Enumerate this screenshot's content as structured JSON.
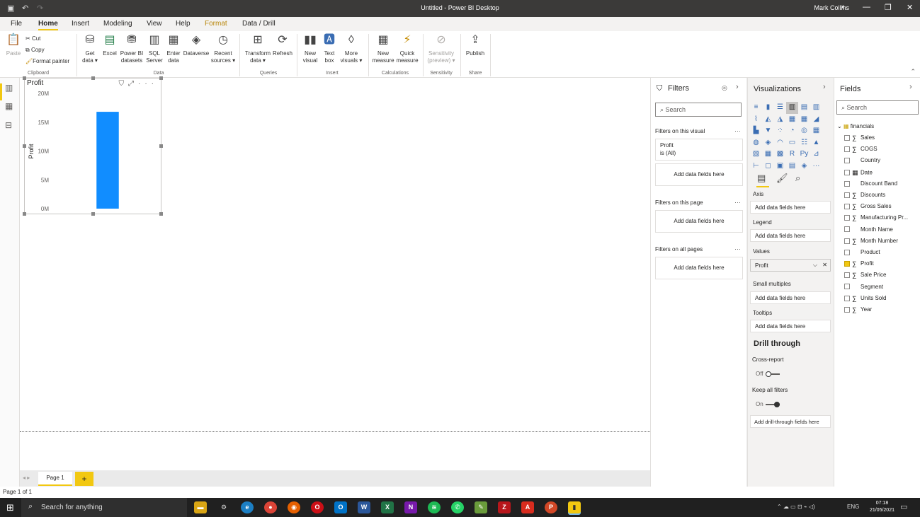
{
  "window": {
    "title": "Untitled - Power BI Desktop",
    "user": "Mark Collins"
  },
  "menu": [
    "File",
    "Home",
    "Insert",
    "Modeling",
    "View",
    "Help",
    "Format",
    "Data / Drill"
  ],
  "ribbon": {
    "paste": "Paste",
    "cut": "Cut",
    "copy": "Copy",
    "format_painter": "Format painter",
    "get_data": [
      "Get",
      "data ▾"
    ],
    "excel": "Excel",
    "pbi_datasets": [
      "Power BI",
      "datasets"
    ],
    "sql_server": [
      "SQL",
      "Server"
    ],
    "enter_data": [
      "Enter",
      "data"
    ],
    "dataverse": "Dataverse",
    "recent_sources": [
      "Recent",
      "sources ▾"
    ],
    "transform_data": [
      "Transform",
      "data ▾"
    ],
    "refresh": "Refresh",
    "new_visual": [
      "New",
      "visual"
    ],
    "text_box": [
      "Text",
      "box"
    ],
    "more_visuals": [
      "More",
      "visuals ▾"
    ],
    "new_measure": [
      "New",
      "measure"
    ],
    "quick_measure": [
      "Quick",
      "measure"
    ],
    "sensitivity": [
      "Sensitivity",
      "(preview) ▾"
    ],
    "publish": "Publish",
    "groups": [
      "Clipboard",
      "Data",
      "Queries",
      "Insert",
      "Calculations",
      "Sensitivity",
      "Share"
    ]
  },
  "visual": {
    "title": "Profit",
    "ylabel": "Profit",
    "icons": [
      "filter-icon",
      "focus-mode-icon",
      "more-options-icon"
    ]
  },
  "chart_data": {
    "type": "bar",
    "categories": [
      ""
    ],
    "values": [
      16.8
    ],
    "ylabel": "Profit",
    "ylim": [
      0,
      20
    ],
    "yticks": [
      "20M",
      "15M",
      "10M",
      "5M",
      "0M"
    ],
    "bar_color": "#118dff"
  },
  "pages": {
    "tab": "Page 1",
    "add": "+",
    "status": "Page 1 of 1"
  },
  "filters": {
    "title": "Filters",
    "search": "Search",
    "on_visual": "Filters on this visual",
    "card_field": "Profit",
    "card_value": "is (All)",
    "add_here": "Add data fields here",
    "on_page": "Filters on this page",
    "on_all": "Filters on all pages",
    "dots": "···"
  },
  "viz": {
    "title": "Visualizations",
    "axis": "Axis",
    "legend": "Legend",
    "values": "Values",
    "values_field": "Profit",
    "small_multiples": "Small multiples",
    "tooltips": "Tooltips",
    "add_here": "Add data fields here",
    "drill_through": "Drill through",
    "cross_report": "Cross-report",
    "off": "Off",
    "keep_filters": "Keep all filters",
    "on": "On",
    "add_drill": "Add drill-through fields here"
  },
  "fields": {
    "title": "Fields",
    "search": "Search",
    "table": "financials",
    "items": [
      {
        "name": "Sales",
        "sigma": "∑",
        "checked": false
      },
      {
        "name": "COGS",
        "sigma": "∑",
        "checked": false
      },
      {
        "name": "Country",
        "sigma": "",
        "checked": false
      },
      {
        "name": "Date",
        "sigma": "▦",
        "checked": false
      },
      {
        "name": "Discount Band",
        "sigma": "",
        "checked": false
      },
      {
        "name": "Discounts",
        "sigma": "∑",
        "checked": false
      },
      {
        "name": "Gross Sales",
        "sigma": "∑",
        "checked": false
      },
      {
        "name": "Manufacturing Pr...",
        "sigma": "∑",
        "checked": false
      },
      {
        "name": "Month Name",
        "sigma": "",
        "checked": false
      },
      {
        "name": "Month Number",
        "sigma": "∑",
        "checked": false
      },
      {
        "name": "Product",
        "sigma": "",
        "checked": false
      },
      {
        "name": "Profit",
        "sigma": "∑",
        "checked": true
      },
      {
        "name": "Sale Price",
        "sigma": "∑",
        "checked": false
      },
      {
        "name": "Segment",
        "sigma": "",
        "checked": false
      },
      {
        "name": "Units Sold",
        "sigma": "∑",
        "checked": false
      },
      {
        "name": "Year",
        "sigma": "∑",
        "checked": false
      }
    ]
  },
  "taskbar": {
    "search": "Search for anything",
    "lang": "ENG",
    "time": "07:18",
    "date": "21/05/2021"
  }
}
